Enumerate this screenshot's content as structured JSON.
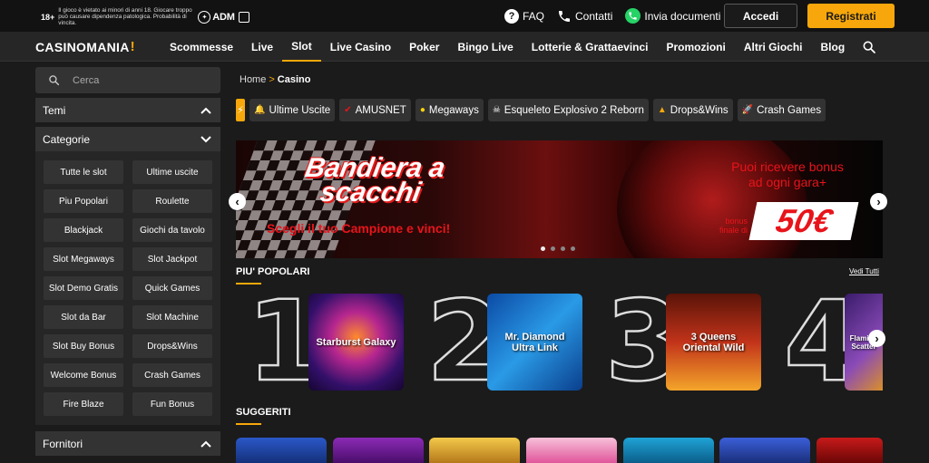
{
  "legal": {
    "age": "18+",
    "text": "Il gioco è vietato ai minori di anni 18. Giocare troppo può causare dipendenza patologica. Probabilità di vincita.",
    "regulator": "ADM"
  },
  "top_links": {
    "faq": "FAQ",
    "contacts": "Contatti",
    "documents": "Invia documenti"
  },
  "auth": {
    "login": "Accedi",
    "register": "Registrati"
  },
  "brand": {
    "name": "CASINOMANIA",
    "accent": "!"
  },
  "nav": {
    "items": [
      "Scommesse",
      "Live",
      "Slot",
      "Live Casino",
      "Poker",
      "Bingo Live",
      "Lotterie & Grattaevinci",
      "Promozioni",
      "Altri Giochi",
      "Blog"
    ],
    "active": "Slot"
  },
  "sidebar": {
    "search_placeholder": "Cerca",
    "temi": "Temi",
    "categorie": "Categorie",
    "fornitori": "Fornitori",
    "categories": [
      "Tutte le slot",
      "Ultime uscite",
      "Piu Popolari",
      "Roulette",
      "Blackjack",
      "Giochi da tavolo",
      "Slot Megaways",
      "Slot Jackpot",
      "Slot Demo Gratis",
      "Quick Games",
      "Slot da Bar",
      "Slot Machine",
      "Slot Buy Bonus",
      "Drops&Wins",
      "Welcome Bonus",
      "Crash Games",
      "Fire Blaze",
      "Fun Bonus"
    ]
  },
  "breadcrumb": {
    "home": "Home",
    "separator": ">",
    "current": "Casino"
  },
  "chips": [
    {
      "icon": "🔔",
      "label": "Ultime Uscite"
    },
    {
      "icon": "✔",
      "label": "AMUSNET"
    },
    {
      "icon": "●",
      "label": "Megaways"
    },
    {
      "icon": "☠",
      "label": "Esqueleto Explosivo 2 Reborn"
    },
    {
      "icon": "▲",
      "label": "Drops&Wins"
    },
    {
      "icon": "🚀",
      "label": "Crash Games"
    }
  ],
  "banner": {
    "title": "Bandiera a scacchi",
    "subtitle": "Scegli il tuo Campione e vinci!",
    "bonus_text": "Puoi ricevere bonus ad ogni gara+",
    "bonus_small": "bonus finale di",
    "amount": "50€",
    "slides": 4,
    "active_slide": 1
  },
  "popular": {
    "title": "PIU' POPOLARI",
    "see_all": "Vedi Tutti",
    "games": [
      {
        "rank": "1",
        "name": "Starburst Galaxy"
      },
      {
        "rank": "2",
        "name": "Mr. Diamond Ultra Link"
      },
      {
        "rank": "3",
        "name": "3 Queens Oriental Wild"
      },
      {
        "rank": "4",
        "name": "Flaming Scatter"
      }
    ]
  },
  "suggested": {
    "title": "SUGGERITI"
  },
  "colors": {
    "accent": "#f7a70b",
    "banner_red": "#e8141b",
    "background": "#1b1b1b",
    "panel": "#262626"
  }
}
